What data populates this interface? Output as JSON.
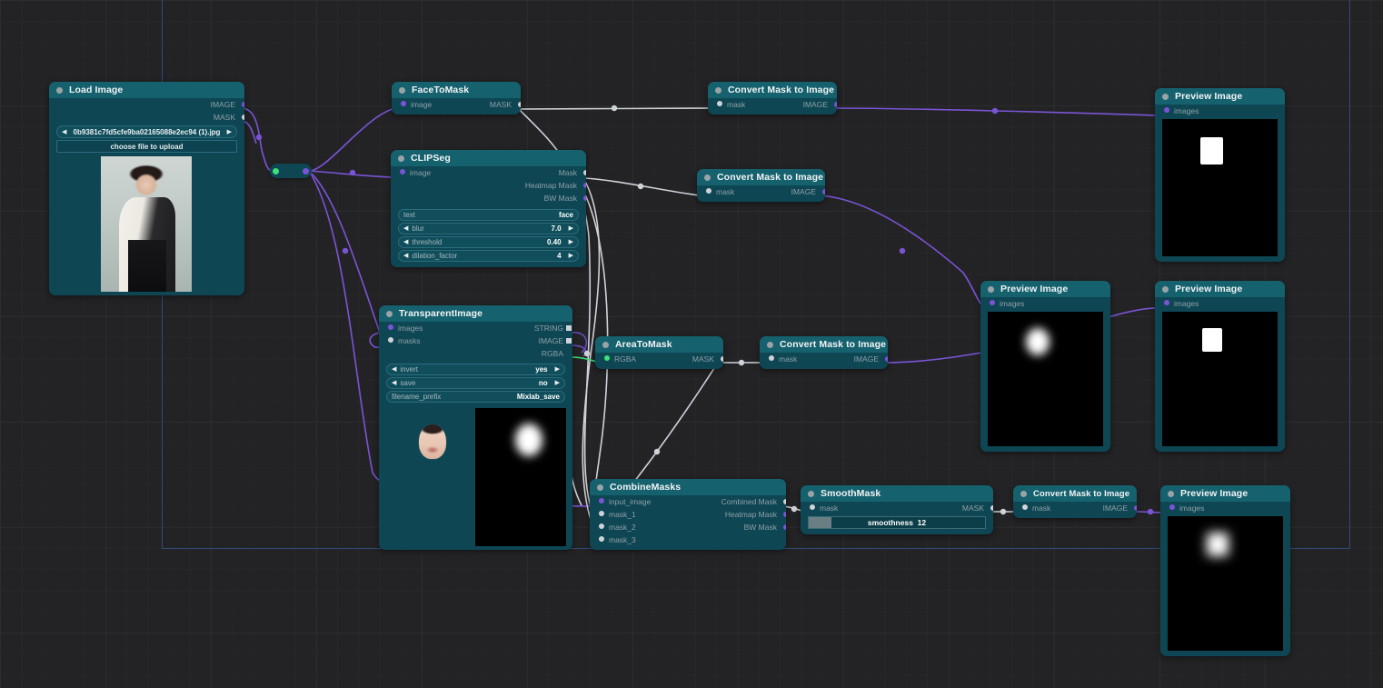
{
  "canvas": {
    "bg_color": "#232325",
    "guide_color": "#2e4a74"
  },
  "colors": {
    "node_header": "#15616e",
    "node_body": "#0e4654",
    "image_link": "#7b54d6",
    "mask_link": "#cfd3d8",
    "rgba_link": "#3fe07a",
    "pin_image": "#7b54d6",
    "pin_mask": "#cfd3d8",
    "pin_rgba": "#3fe07a"
  },
  "nodes": {
    "load_image": {
      "title": "Load Image",
      "outputs": [
        {
          "label": "IMAGE",
          "type": "image"
        },
        {
          "label": "MASK",
          "type": "mask"
        }
      ],
      "filename": "0b9381c7fd5cfe9ba02165088e2ec94 (1).jpg",
      "upload_button": "choose file to upload"
    },
    "face_to_mask": {
      "title": "FaceToMask",
      "inputs": [
        {
          "label": "image",
          "type": "image"
        }
      ],
      "outputs": [
        {
          "label": "MASK",
          "type": "mask"
        }
      ]
    },
    "clipseg": {
      "title": "CLIPSeg",
      "inputs": [
        {
          "label": "image",
          "type": "image"
        }
      ],
      "outputs": [
        {
          "label": "Mask",
          "type": "mask"
        },
        {
          "label": "Heatmap Mask",
          "type": "image"
        },
        {
          "label": "BW Mask",
          "type": "image"
        }
      ],
      "widgets": [
        {
          "name": "text",
          "value": "face",
          "kind": "text"
        },
        {
          "name": "blur",
          "value": "7.0",
          "kind": "number"
        },
        {
          "name": "threshold",
          "value": "0.40",
          "kind": "number"
        },
        {
          "name": "dilation_factor",
          "value": "4",
          "kind": "number"
        }
      ]
    },
    "transparent_image": {
      "title": "TransparentImage",
      "inputs": [
        {
          "label": "images",
          "type": "image"
        },
        {
          "label": "masks",
          "type": "mask"
        }
      ],
      "outputs": [
        {
          "label": "STRING",
          "type": "string"
        },
        {
          "label": "IMAGE",
          "type": "image"
        },
        {
          "label": "RGBA",
          "type": "rgba"
        }
      ],
      "widgets": [
        {
          "name": "invert",
          "value": "yes",
          "kind": "combo"
        },
        {
          "name": "save",
          "value": "no",
          "kind": "combo"
        },
        {
          "name": "filename_prefix",
          "value": "Mixlab_save",
          "kind": "text"
        }
      ]
    },
    "area_to_mask": {
      "title": "AreaToMask",
      "inputs": [
        {
          "label": "RGBA",
          "type": "rgba"
        }
      ],
      "outputs": [
        {
          "label": "MASK",
          "type": "mask"
        }
      ]
    },
    "combine_masks": {
      "title": "CombineMasks",
      "inputs": [
        {
          "label": "input_image",
          "type": "image"
        },
        {
          "label": "mask_1",
          "type": "mask"
        },
        {
          "label": "mask_2",
          "type": "mask"
        },
        {
          "label": "mask_3",
          "type": "mask"
        }
      ],
      "outputs": [
        {
          "label": "Combined Mask",
          "type": "mask"
        },
        {
          "label": "Heatmap Mask",
          "type": "image"
        },
        {
          "label": "BW Mask",
          "type": "image"
        }
      ]
    },
    "smooth_mask": {
      "title": "SmoothMask",
      "inputs": [
        {
          "label": "mask",
          "type": "mask"
        }
      ],
      "outputs": [
        {
          "label": "MASK",
          "type": "mask"
        }
      ],
      "widget": {
        "name": "smoothness",
        "value": "12",
        "fill_percent": 13
      }
    },
    "convert_1": {
      "title": "Convert Mask to Image",
      "inputs": [
        {
          "label": "mask",
          "type": "mask"
        }
      ],
      "outputs": [
        {
          "label": "IMAGE",
          "type": "image"
        }
      ]
    },
    "convert_2": {
      "title": "Convert Mask to Image",
      "inputs": [
        {
          "label": "mask",
          "type": "mask"
        }
      ],
      "outputs": [
        {
          "label": "IMAGE",
          "type": "image"
        }
      ]
    },
    "convert_3": {
      "title": "Convert Mask to Image",
      "inputs": [
        {
          "label": "mask",
          "type": "mask"
        }
      ],
      "outputs": [
        {
          "label": "IMAGE",
          "type": "image"
        }
      ]
    },
    "convert_4": {
      "title": "Convert Mask to Image",
      "inputs": [
        {
          "label": "mask",
          "type": "mask"
        }
      ],
      "outputs": [
        {
          "label": "IMAGE",
          "type": "image"
        }
      ]
    },
    "preview_1": {
      "title": "Preview Image",
      "inputs": [
        {
          "label": "images",
          "type": "image"
        }
      ],
      "preview": "black-with-white-square"
    },
    "preview_2": {
      "title": "Preview Image",
      "inputs": [
        {
          "label": "images",
          "type": "image"
        }
      ],
      "preview": "black-with-blurred-white-blob"
    },
    "preview_3": {
      "title": "Preview Image",
      "inputs": [
        {
          "label": "images",
          "type": "image"
        }
      ],
      "preview": "black-with-white-square"
    },
    "preview_4": {
      "title": "Preview Image",
      "inputs": [
        {
          "label": "images",
          "type": "image"
        }
      ],
      "preview": "black-with-soft-white-square"
    },
    "reroute": {
      "title": "reroute",
      "input_type": "rgba",
      "output_type": "image"
    }
  }
}
